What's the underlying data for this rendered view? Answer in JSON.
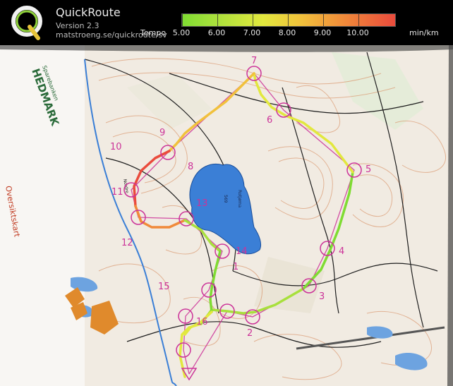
{
  "header": {
    "app_title": "QuickRoute",
    "version": "Version 2.3",
    "url": "matstroeng.se/quickroute/sv",
    "tempo_label": "Tempo",
    "unit_label": "min/km",
    "legend_ticks": [
      "5.00",
      "6.00",
      "7.00",
      "8.00",
      "9.00",
      "10.00"
    ],
    "logo_letter": "Q"
  },
  "map": {
    "sponsor_line1": "Sparebanken",
    "sponsor_line2": "HEDMARK",
    "overview_label": "Oversiktskart",
    "lake_name": "Rotjørna",
    "lake_elevation": "569",
    "place_label": "Nordre",
    "control_numbers": [
      "1",
      "2",
      "3",
      "4",
      "5",
      "6",
      "7",
      "8",
      "9",
      "10",
      "11",
      "12",
      "13",
      "14",
      "15",
      "16"
    ]
  },
  "colors": {
    "header_bg": "#000000",
    "route_fast": "#7fdc32",
    "route_slow": "#ea4b3c",
    "controls": "#cc3399",
    "lake": "#3b7fd6",
    "map_paper": "#f3ede4"
  }
}
